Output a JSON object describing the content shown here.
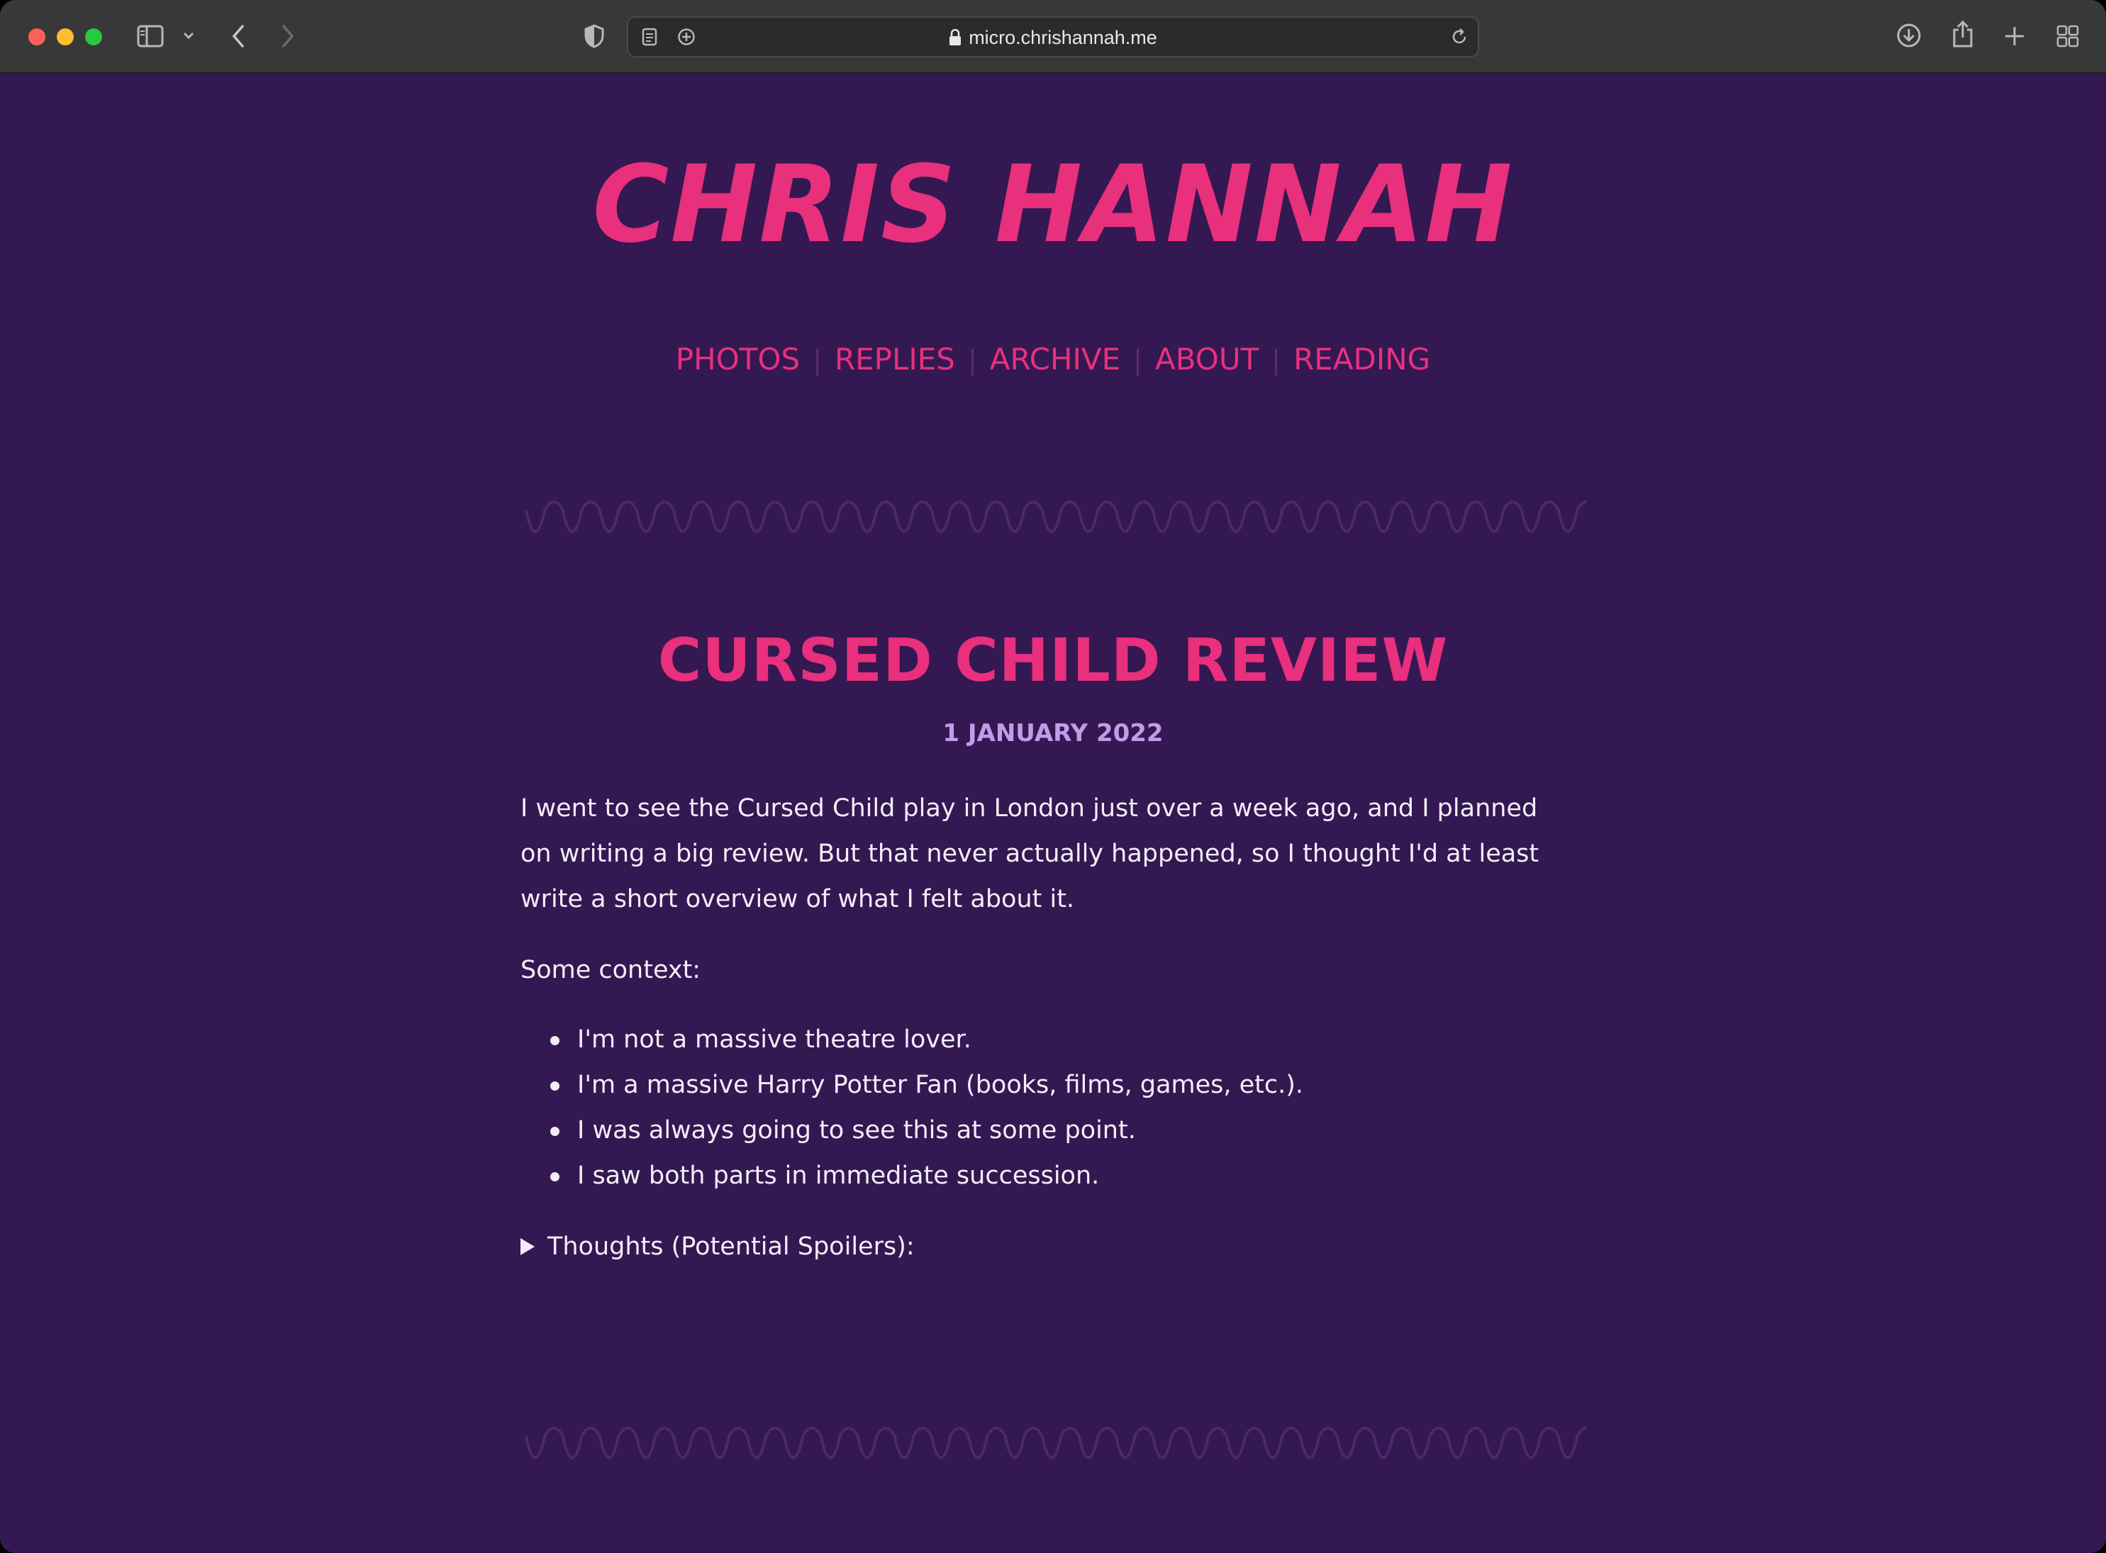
{
  "browser": {
    "url": "micro.chrishannah.me"
  },
  "site": {
    "title": "CHRIS HANNAH",
    "nav": [
      "PHOTOS",
      "REPLIES",
      "ARCHIVE",
      "ABOUT",
      "READING"
    ]
  },
  "post": {
    "title": "CURSED CHILD REVIEW",
    "date": "1 JANUARY 2022",
    "intro": "I went to see the Cursed Child play in London just over a week ago, and I planned on writing a big review. But that never actually happened, so I thought I'd at least write a short overview of what I felt about it.",
    "context_label": "Some context:",
    "context_items": [
      "I'm not a massive theatre lover.",
      "I'm a massive Harry Potter Fan (books, films, games, etc.).",
      "I was always going to see this at some point.",
      "I saw both parts in immediate succession."
    ],
    "details_summary": "Thoughts (Potential Spoilers):"
  },
  "colors": {
    "background": "#341852",
    "accent": "#e8307c",
    "date": "#c49be8",
    "text": "#f3eef7",
    "wave": "#4a2a6a"
  }
}
